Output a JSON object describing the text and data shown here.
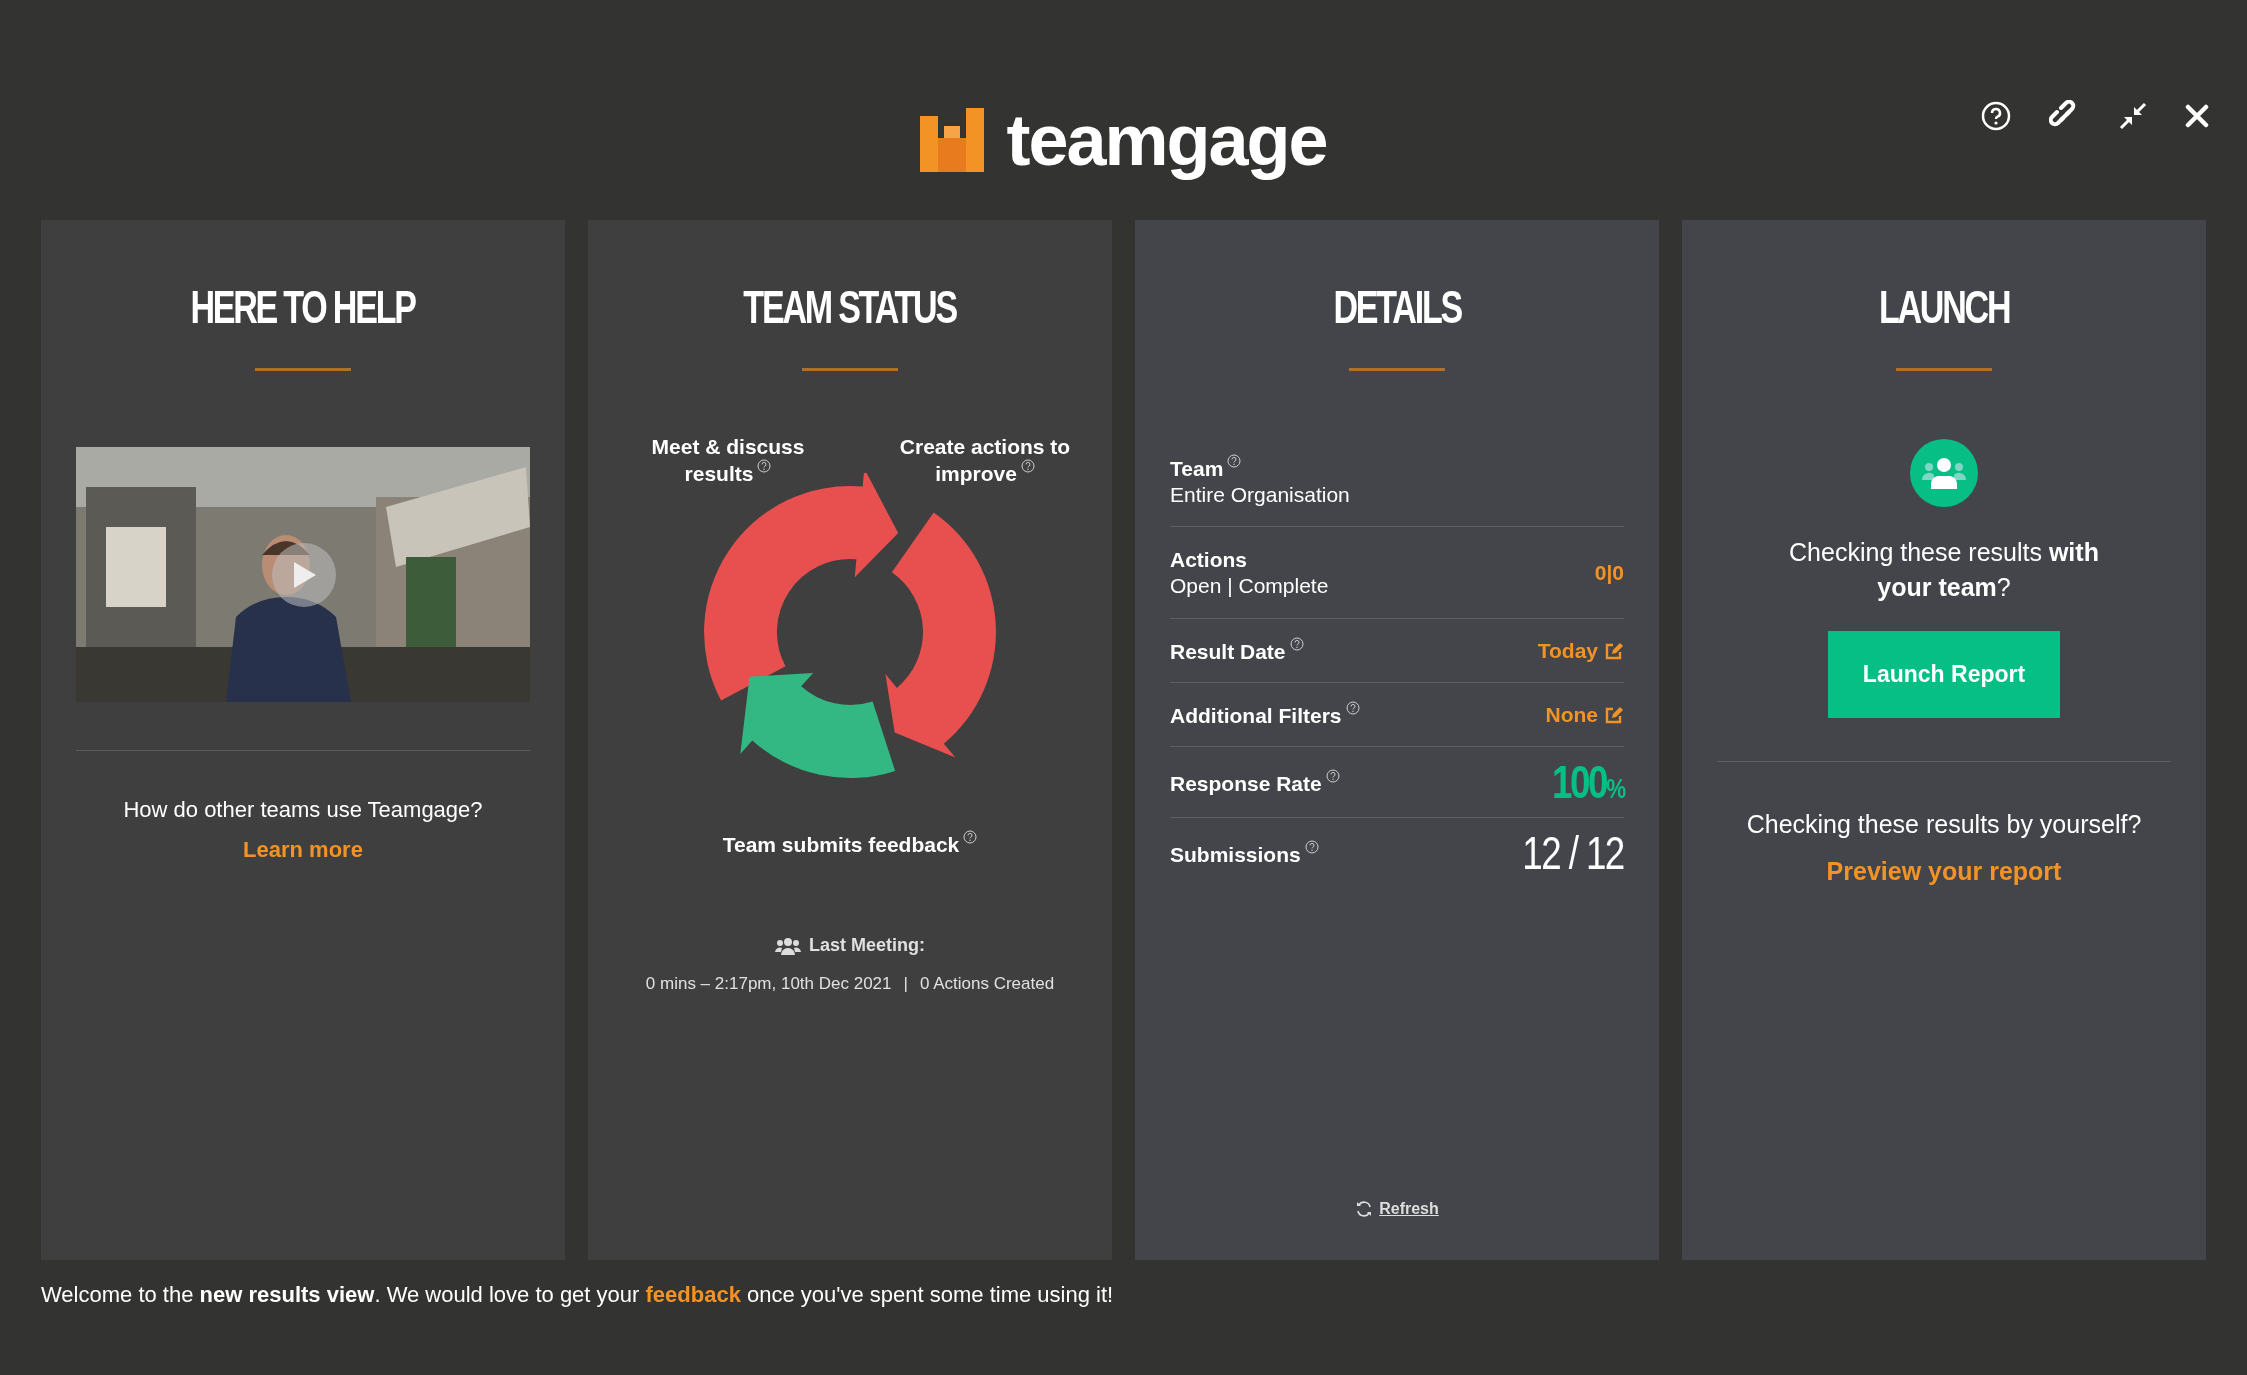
{
  "header": {
    "logo": "teamgage"
  },
  "help_panel": {
    "title": "HERE TO HELP",
    "question": "How do other teams use Teamgage?",
    "link": "Learn more"
  },
  "status_panel": {
    "title": "TEAM STATUS",
    "steps": [
      {
        "label": "Meet & discuss results",
        "help": true
      },
      {
        "label": "Create actions to improve",
        "help": true
      },
      {
        "label": "Team submits feedback",
        "help": true
      }
    ],
    "last_meeting": {
      "label": "Last Meeting:",
      "summary": "0 mins – 2:17pm, 10th Dec 2021",
      "separator": "|",
      "actions": "0 Actions Created"
    }
  },
  "details_panel": {
    "title": "DETAILS",
    "rows": [
      {
        "kind": "text",
        "label": "Team",
        "help": true,
        "value": "Entire Organisation"
      },
      {
        "kind": "counts",
        "label": "Actions",
        "help": false,
        "sublabel": "Open | Complete",
        "value": "0|0"
      },
      {
        "kind": "edit",
        "label": "Result Date",
        "help": true,
        "value": "Today"
      },
      {
        "kind": "edit",
        "label": "Additional Filters",
        "help": true,
        "value": "None"
      },
      {
        "kind": "percent",
        "label": "Response Rate",
        "help": true,
        "value": "100",
        "unit": "%"
      },
      {
        "kind": "ratio",
        "label": "Submissions",
        "help": true,
        "value": "12 / 12"
      }
    ],
    "refresh": "Refresh"
  },
  "launch_panel": {
    "title": "LAUNCH",
    "question": "Checking these results **with your team**?",
    "button": "Launch Report",
    "alt_question": "Checking these results by yourself?",
    "link": "Preview your report"
  },
  "footer": {
    "before": "Welcome to the **new results view**. We would love to get your ",
    "link": "feedback",
    "after": " once you've spent some time using it!"
  }
}
